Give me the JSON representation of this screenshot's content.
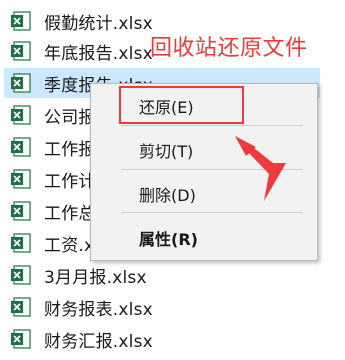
{
  "files": [
    {
      "name": "假勤统计.xlsx"
    },
    {
      "name": "年底报告.xlsx"
    },
    {
      "name": "季度报告.xlsx",
      "selected": true
    },
    {
      "name": "公司报"
    },
    {
      "name": "工作报"
    },
    {
      "name": "工作计"
    },
    {
      "name": "工作总"
    },
    {
      "name": "工资.x"
    },
    {
      "name": "3月月报.xlsx"
    },
    {
      "name": "财务报表.xlsx"
    },
    {
      "name": "财务汇报.xlsx"
    }
  ],
  "annotation": {
    "text": "回收站还原文件",
    "color": "#ee3a3a"
  },
  "context_menu": {
    "restore": "还原(E)",
    "cut": "剪切(T)",
    "delete": "删除(D)",
    "properties": "属性(R)"
  },
  "icons": {
    "file": "excel-icon",
    "arrow": "arrow-icon"
  },
  "colors": {
    "accent": "#ee3a3a",
    "selection": "#cce8ff",
    "excel_green": "#1e7145"
  }
}
